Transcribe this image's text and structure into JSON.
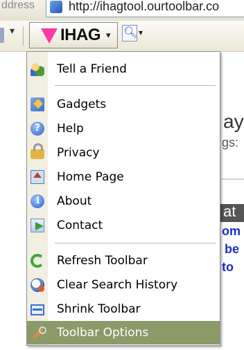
{
  "browser": {
    "address_label": "ddress",
    "url": "http://ihagtool.ourtoolbar.co"
  },
  "toolbar": {
    "left_dropdown": "▾",
    "name": "IHAG",
    "name_dropdown": "▾",
    "search_dropdown": "▾"
  },
  "background_page": {
    "word1": "ay",
    "word2": "gs:",
    "bar_text": "at",
    "links": [
      "om",
      "be",
      "to"
    ]
  },
  "menu": {
    "items": [
      {
        "label": "Tell a Friend",
        "icon": "tell-a-friend-icon"
      },
      {
        "label": "Gadgets",
        "icon": "gadgets-icon"
      },
      {
        "label": "Help",
        "icon": "help-icon"
      },
      {
        "label": "Privacy",
        "icon": "privacy-lock-icon"
      },
      {
        "label": "Home Page",
        "icon": "home-page-icon"
      },
      {
        "label": "About",
        "icon": "about-info-icon"
      },
      {
        "label": "Contact",
        "icon": "contact-mail-icon"
      },
      {
        "label": "Refresh Toolbar",
        "icon": "refresh-icon"
      },
      {
        "label": "Clear Search History",
        "icon": "clear-history-icon"
      },
      {
        "label": "Shrink Toolbar",
        "icon": "shrink-toolbar-icon"
      },
      {
        "label": "Toolbar Options",
        "icon": "toolbar-options-icon"
      }
    ],
    "selected_item": "Toolbar Options",
    "highlight_color": "#8c9a6a"
  },
  "colors": {
    "logo_pink": "#ff3aa6",
    "link_blue": "#1b2fbf"
  }
}
